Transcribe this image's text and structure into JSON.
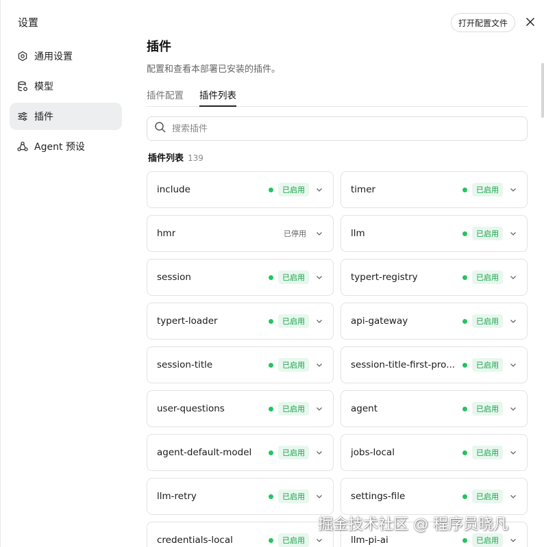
{
  "sidebar": {
    "title": "设置",
    "items": [
      {
        "label": "通用设置",
        "icon": "gear-icon",
        "active": false
      },
      {
        "label": "模型",
        "icon": "database-icon",
        "active": false
      },
      {
        "label": "插件",
        "icon": "sliders-icon",
        "active": true
      },
      {
        "label": "Agent 预设",
        "icon": "agent-icon",
        "active": false
      }
    ]
  },
  "header": {
    "open_config_label": "打开配置文件",
    "close_icon": "close-icon"
  },
  "main": {
    "title": "插件",
    "description": "配置和查看本部署已安装的插件。",
    "tabs": [
      {
        "label": "插件配置",
        "active": false
      },
      {
        "label": "插件列表",
        "active": true
      }
    ],
    "search": {
      "placeholder": "搜索插件",
      "value": ""
    },
    "list_title": "插件列表",
    "list_count": "139",
    "plugins": [
      {
        "name": "include",
        "status": "已启用",
        "enabled": true
      },
      {
        "name": "timer",
        "status": "已启用",
        "enabled": true
      },
      {
        "name": "hmr",
        "status": "已停用",
        "enabled": false
      },
      {
        "name": "llm",
        "status": "已启用",
        "enabled": true
      },
      {
        "name": "session",
        "status": "已启用",
        "enabled": true
      },
      {
        "name": "typert-registry",
        "status": "已启用",
        "enabled": true
      },
      {
        "name": "typert-loader",
        "status": "已启用",
        "enabled": true
      },
      {
        "name": "api-gateway",
        "status": "已启用",
        "enabled": true
      },
      {
        "name": "session-title",
        "status": "已启用",
        "enabled": true
      },
      {
        "name": "session-title-first-pro...",
        "status": "已启用",
        "enabled": true
      },
      {
        "name": "user-questions",
        "status": "已启用",
        "enabled": true
      },
      {
        "name": "agent",
        "status": "已启用",
        "enabled": true
      },
      {
        "name": "agent-default-model",
        "status": "已启用",
        "enabled": true
      },
      {
        "name": "jobs-local",
        "status": "已启用",
        "enabled": true
      },
      {
        "name": "llm-retry",
        "status": "已启用",
        "enabled": true
      },
      {
        "name": "settings-file",
        "status": "已启用",
        "enabled": true
      },
      {
        "name": "credentials-local",
        "status": "已启用",
        "enabled": true
      },
      {
        "name": "llm-pi-ai",
        "status": "已启用",
        "enabled": true
      }
    ]
  },
  "colors": {
    "enabled_dot": "#22c55e",
    "enabled_text": "#16a34a",
    "enabled_bg": "#e8f7ee",
    "active_nav_bg": "#eceef0"
  },
  "watermark": "掘金技术社区 @ 程序员晓凡"
}
